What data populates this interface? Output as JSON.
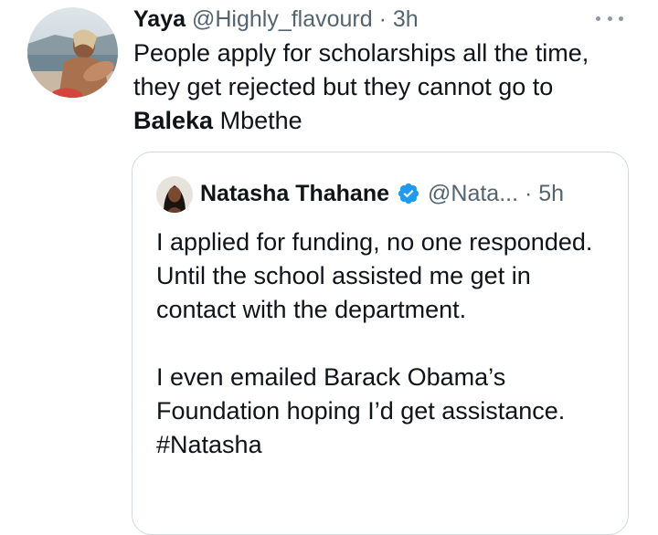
{
  "tweet": {
    "author_name": "Yaya",
    "author_handle": "@Highly_flavourd",
    "separator": "·",
    "time": "3h",
    "text_line_1": "People apply for scholarships all the time,",
    "text_line_2": "they get rejected but they cannot go to",
    "text_bold": "Baleka",
    "text_rest": " Mbethe"
  },
  "quote": {
    "author_name": "Natasha Thahane",
    "author_handle": "@Nata...",
    "separator": "·",
    "time": "5h",
    "paragraph_1": "I applied for funding, no one responded. Until the school assisted me get in contact with the department.",
    "paragraph_2": "I even emailed Barack Obama’s Foundation hoping I’d get assistance. #Natasha"
  },
  "icons": {
    "more": "more-horizontal-icon",
    "verified": "verified-badge-icon"
  },
  "colors": {
    "text": "#0f1419",
    "secondary": "#536471",
    "border": "#cfd9de",
    "verified": "#1d9bf0"
  }
}
